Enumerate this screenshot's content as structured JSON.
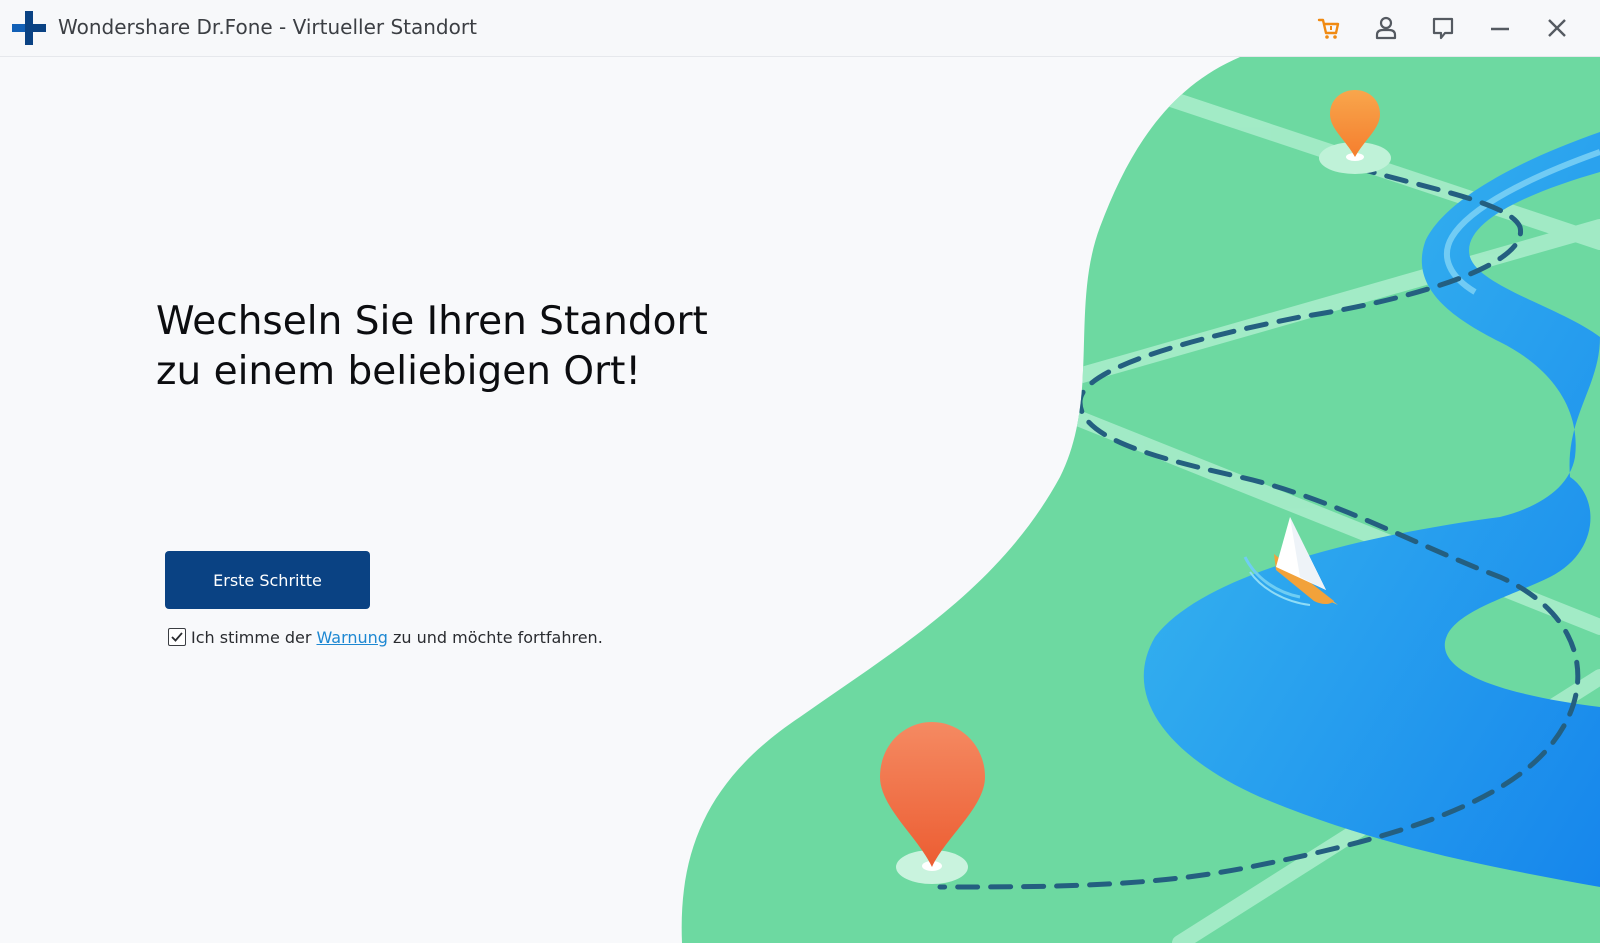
{
  "window": {
    "title": "Wondershare Dr.Fone - Virtueller Standort",
    "icons": [
      "app-logo-icon",
      "cart-icon",
      "user-icon",
      "feedback-icon",
      "minimize-icon",
      "close-icon"
    ],
    "colors": {
      "logo_blue": "#0a4283",
      "cart_orange": "#f08a12",
      "titlebar_bg": "#f7f8fa"
    }
  },
  "main": {
    "headline_line1": "Wechseln Sie Ihren Standort",
    "headline_line2": "zu einem beliebigen Ort!",
    "start_button_label": "Erste Schritte",
    "consent": {
      "checked": true,
      "text_before": "Ich stimme der",
      "link_label": "Warnung",
      "text_after": "zu und möchte fortfahren."
    },
    "colors": {
      "button_bg": "#0a4283",
      "link": "#1e88d2",
      "land": "#6dd9a1",
      "river": "#1f98ef",
      "pin": "#f0703f"
    }
  },
  "illustration": {
    "icons": [
      "map-pin-icon",
      "map-pin-icon",
      "sailboat-icon"
    ]
  }
}
